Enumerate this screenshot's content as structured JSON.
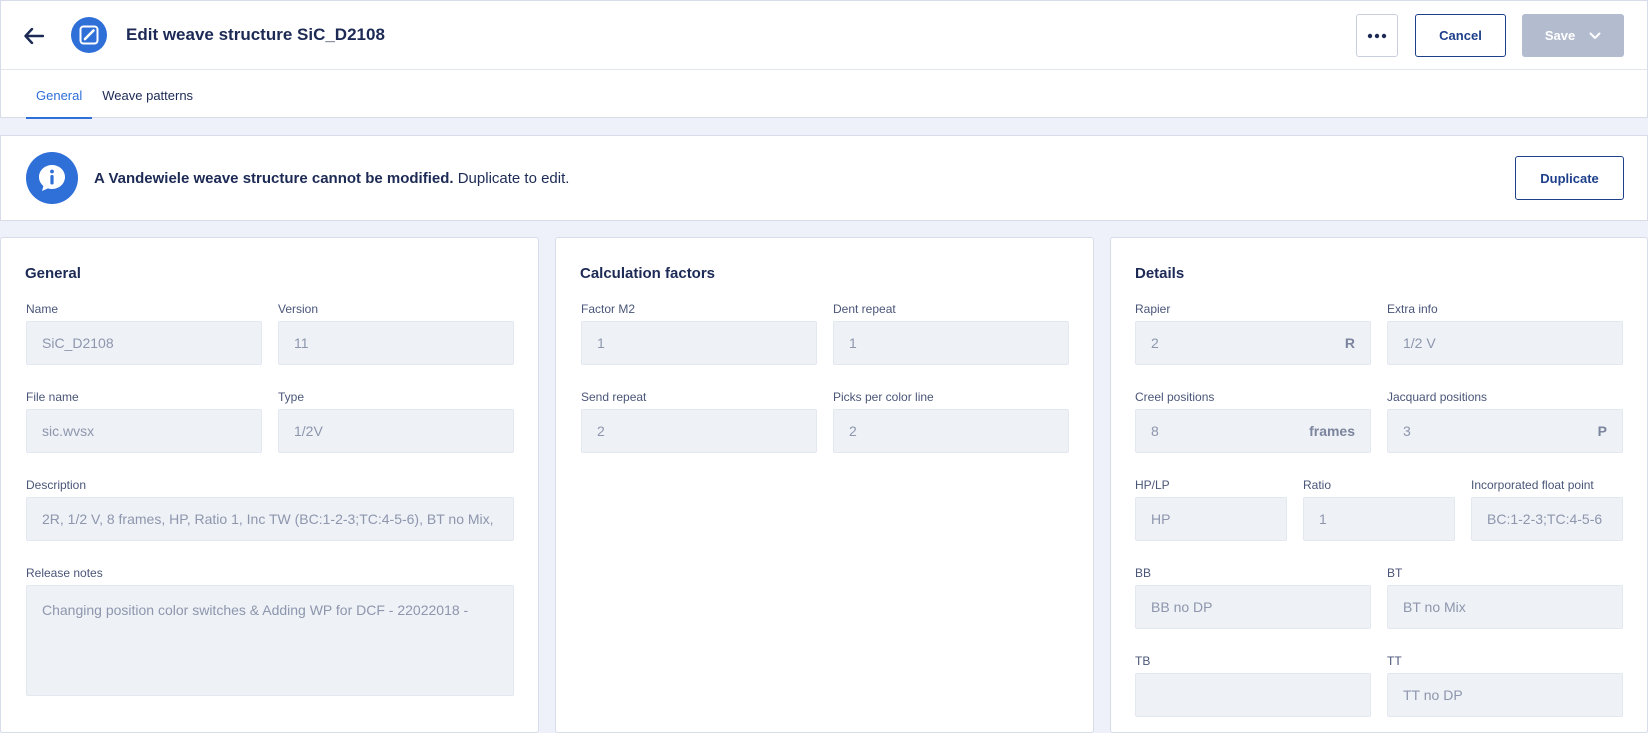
{
  "header": {
    "title": "Edit weave structure SiC_D2108",
    "more_label": "•••",
    "cancel_label": "Cancel",
    "save_label": "Save"
  },
  "tabs": [
    {
      "label": "General",
      "active": true
    },
    {
      "label": "Weave patterns",
      "active": false
    }
  ],
  "banner": {
    "bold_text": "A Vandewiele weave structure cannot be modified.",
    "text": " Duplicate to edit.",
    "duplicate_label": "Duplicate"
  },
  "general": {
    "title": "General",
    "name": {
      "label": "Name",
      "value": "SiC_D2108"
    },
    "version": {
      "label": "Version",
      "value": "11"
    },
    "file_name": {
      "label": "File name",
      "value": "sic.wvsx"
    },
    "type": {
      "label": "Type",
      "value": "1/2V"
    },
    "description": {
      "label": "Description",
      "value": "2R, 1/2 V, 8 frames, HP, Ratio 1, Inc TW (BC:1-2-3;TC:4-5-6), BT no Mix,"
    },
    "release_notes": {
      "label": "Release notes",
      "value": "Changing position color switches & Adding WP for DCF - 22022018 -"
    }
  },
  "calculation": {
    "title": "Calculation factors",
    "factor_m2": {
      "label": "Factor M2",
      "value": "1"
    },
    "dent_repeat": {
      "label": "Dent repeat",
      "value": "1"
    },
    "send_repeat": {
      "label": "Send repeat",
      "value": "2"
    },
    "picks_per_color_line": {
      "label": "Picks per color line",
      "value": "2"
    }
  },
  "details": {
    "title": "Details",
    "rapier": {
      "label": "Rapier",
      "value": "2",
      "unit": "R"
    },
    "extra_info": {
      "label": "Extra info",
      "value": "1/2 V"
    },
    "creel_positions": {
      "label": "Creel positions",
      "value": "8",
      "unit": "frames"
    },
    "jacquard_positions": {
      "label": "Jacquard positions",
      "value": "3",
      "unit": "P"
    },
    "hp_lp": {
      "label": "HP/LP",
      "value": "HP"
    },
    "ratio": {
      "label": "Ratio",
      "value": "1"
    },
    "incorporated_float_point": {
      "label": "Incorporated float point",
      "value": "BC:1-2-3;TC:4-5-6"
    },
    "bb": {
      "label": "BB",
      "value": "BB no DP"
    },
    "bt": {
      "label": "BT",
      "value": "BT no Mix"
    },
    "tb": {
      "label": "TB",
      "value": ""
    },
    "tt": {
      "label": "TT",
      "value": "TT no DP"
    }
  },
  "colors": {
    "accent": "#2f6fd8",
    "navy": "#1e3f8a",
    "text": "#1c2a55",
    "disabled_button": "#b3bbce",
    "background": "#eef1f9"
  },
  "icons": {
    "back": "arrow-left-icon",
    "edit": "pencil-icon",
    "more": "ellipsis-icon",
    "save_menu": "chevron-down-icon",
    "info": "info-icon"
  }
}
